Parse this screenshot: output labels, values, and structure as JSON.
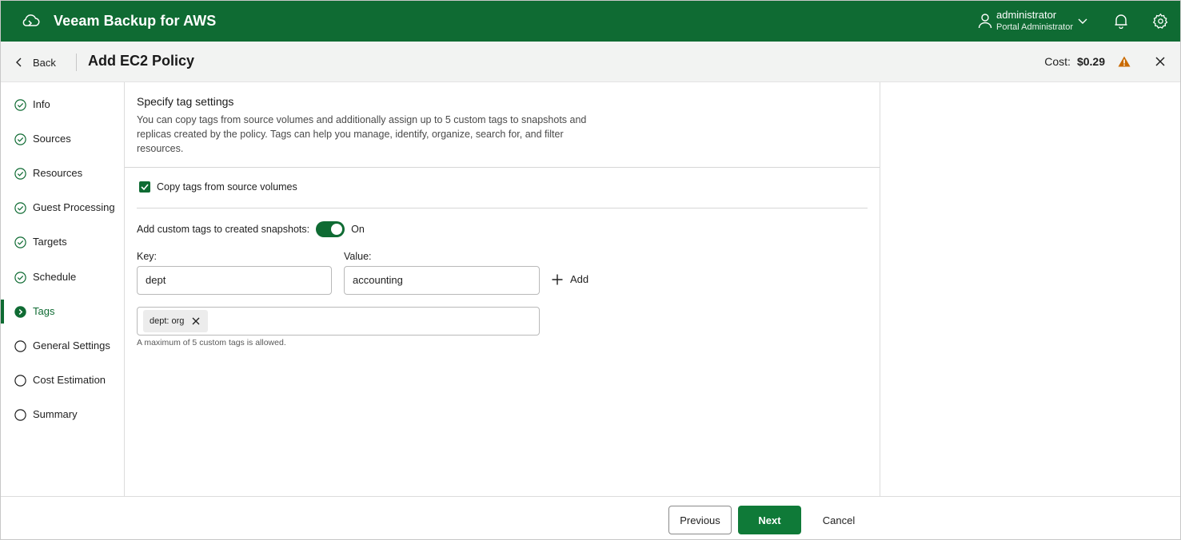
{
  "header": {
    "app_title": "Veeam Backup for AWS",
    "user_name": "administrator",
    "user_role": "Portal Administrator",
    "brand_color": "#0f6b33"
  },
  "subheader": {
    "back_label": "Back",
    "page_title": "Add EC2 Policy",
    "cost_label": "Cost:",
    "cost_value": "$0.29",
    "warning_color": "#c96a00"
  },
  "steps": [
    {
      "label": "Info",
      "status": "done"
    },
    {
      "label": "Sources",
      "status": "done"
    },
    {
      "label": "Resources",
      "status": "done"
    },
    {
      "label": "Guest Processing",
      "status": "done"
    },
    {
      "label": "Targets",
      "status": "done"
    },
    {
      "label": "Schedule",
      "status": "done"
    },
    {
      "label": "Tags",
      "status": "current"
    },
    {
      "label": "General Settings",
      "status": "pending"
    },
    {
      "label": "Cost Estimation",
      "status": "pending"
    },
    {
      "label": "Summary",
      "status": "pending"
    }
  ],
  "main": {
    "section_title": "Specify tag settings",
    "section_desc": "You can copy tags from source volumes and additionally assign up to 5 custom tags to snapshots and replicas created by the policy. Tags can help you manage, identify, organize, search for, and filter resources.",
    "copy_tags_label": "Copy tags from source volumes",
    "copy_tags_checked": true,
    "custom_tags_label": "Add custom tags to created snapshots:",
    "custom_tags_state": "On",
    "key_label": "Key:",
    "value_label": "Value:",
    "key_value": "dept",
    "value_value": "accounting",
    "add_label": "Add",
    "tags": [
      "dept: org"
    ],
    "tags_hint": "A maximum of 5 custom tags is allowed."
  },
  "footer": {
    "previous_label": "Previous",
    "next_label": "Next",
    "cancel_label": "Cancel"
  }
}
